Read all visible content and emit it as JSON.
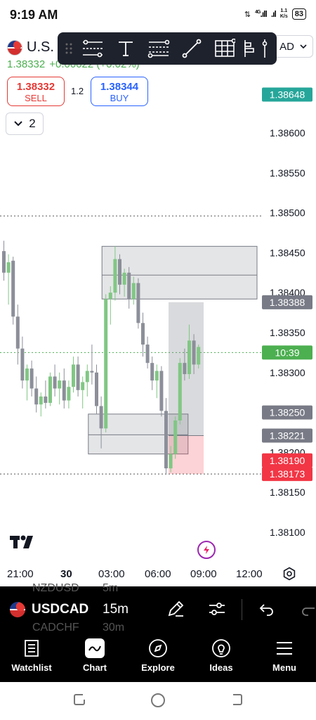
{
  "status_bar": {
    "time": "9:19 AM",
    "network": "4G",
    "speed_value": "1.1",
    "speed_unit": "K/s",
    "battery": "83"
  },
  "header": {
    "symbol": "U.S.",
    "last_price": "1.38332",
    "change": "+0.00022 (+0.02%)",
    "currency": "AD"
  },
  "drawing_toolbar": {
    "tools": [
      "grip-icon",
      "trend-channel-icon",
      "text-icon",
      "fib-icon",
      "trend-line-icon",
      "grid-icon",
      "long-position-icon",
      "vertical-line-icon"
    ]
  },
  "trade": {
    "sell_price": "1.38332",
    "sell_label": "SELL",
    "spread": "1.2",
    "buy_price": "1.38344",
    "buy_label": "BUY"
  },
  "indicators": {
    "count": "2"
  },
  "chart_data": {
    "type": "candlestick",
    "symbol": "USDCAD",
    "interval": "15m",
    "y_ticks": [
      1.381,
      1.3815,
      1.382,
      1.3825,
      1.383,
      1.3835,
      1.384,
      1.3845,
      1.385,
      1.3855,
      1.386
    ],
    "y_tick_labels": [
      "1.38100",
      "1.38150",
      "1.38200",
      "1.38250",
      "1.38300",
      "1.38350",
      "1.38400",
      "1.38450",
      "1.38500",
      "1.38550",
      "1.38600"
    ],
    "ylim": [
      1.3805,
      1.3866
    ],
    "x_ticks": [
      "21:00",
      "30",
      "03:00",
      "06:00",
      "09:00",
      "12:00"
    ],
    "price_tags": [
      {
        "label": "1.38648",
        "value": 1.38648,
        "color": "#26a69a"
      },
      {
        "label": "1.38388",
        "value": 1.38388,
        "color": "#787b86"
      },
      {
        "label": "10:39",
        "value": 1.38325,
        "color": "#4caf50"
      },
      {
        "label": "1.38250",
        "value": 1.3825,
        "color": "#787b86"
      },
      {
        "label": "1.38221",
        "value": 1.38221,
        "color": "#787b86"
      },
      {
        "label": "1.38190",
        "value": 1.3819,
        "color": "#f23645"
      },
      {
        "label": "1.38173",
        "value": 1.38173,
        "color": "#f23645"
      }
    ],
    "dotted_lines": [
      1.38496,
      1.38325,
      1.38173
    ],
    "candles": [
      {
        "o": 1.38452,
        "h": 1.38465,
        "l": 1.38415,
        "c": 1.38425
      },
      {
        "o": 1.38425,
        "h": 1.38448,
        "l": 1.38385,
        "c": 1.38438
      },
      {
        "o": 1.3844,
        "h": 1.38445,
        "l": 1.3836,
        "c": 1.3837
      },
      {
        "o": 1.3837,
        "h": 1.38385,
        "l": 1.3831,
        "c": 1.3833
      },
      {
        "o": 1.3833,
        "h": 1.38345,
        "l": 1.3828,
        "c": 1.3829
      },
      {
        "o": 1.3829,
        "h": 1.3831,
        "l": 1.38265,
        "c": 1.38305
      },
      {
        "o": 1.38305,
        "h": 1.38315,
        "l": 1.3827,
        "c": 1.3828
      },
      {
        "o": 1.3828,
        "h": 1.38295,
        "l": 1.3825,
        "c": 1.3826
      },
      {
        "o": 1.3826,
        "h": 1.38275,
        "l": 1.38245,
        "c": 1.3827
      },
      {
        "o": 1.3827,
        "h": 1.3829,
        "l": 1.38255,
        "c": 1.38262
      },
      {
        "o": 1.38262,
        "h": 1.383,
        "l": 1.38258,
        "c": 1.38295
      },
      {
        "o": 1.38295,
        "h": 1.3831,
        "l": 1.3827,
        "c": 1.3828
      },
      {
        "o": 1.3828,
        "h": 1.383,
        "l": 1.3826,
        "c": 1.3829
      },
      {
        "o": 1.3829,
        "h": 1.38305,
        "l": 1.38255,
        "c": 1.38265
      },
      {
        "o": 1.38265,
        "h": 1.3829,
        "l": 1.38255,
        "c": 1.38282
      },
      {
        "o": 1.38282,
        "h": 1.3832,
        "l": 1.38275,
        "c": 1.3831
      },
      {
        "o": 1.3831,
        "h": 1.3832,
        "l": 1.3827,
        "c": 1.38278
      },
      {
        "o": 1.38278,
        "h": 1.38295,
        "l": 1.38255,
        "c": 1.38288
      },
      {
        "o": 1.38288,
        "h": 1.3831,
        "l": 1.3827,
        "c": 1.38302
      },
      {
        "o": 1.38302,
        "h": 1.38335,
        "l": 1.38285,
        "c": 1.383
      },
      {
        "o": 1.383,
        "h": 1.3831,
        "l": 1.38248,
        "c": 1.38258
      },
      {
        "o": 1.38258,
        "h": 1.3827,
        "l": 1.38205,
        "c": 1.3823
      },
      {
        "o": 1.3823,
        "h": 1.38398,
        "l": 1.38225,
        "c": 1.38392
      },
      {
        "o": 1.38392,
        "h": 1.38408,
        "l": 1.3836,
        "c": 1.384
      },
      {
        "o": 1.384,
        "h": 1.38458,
        "l": 1.3839,
        "c": 1.38442
      },
      {
        "o": 1.38442,
        "h": 1.38448,
        "l": 1.38398,
        "c": 1.3841
      },
      {
        "o": 1.3841,
        "h": 1.3843,
        "l": 1.38395,
        "c": 1.38425
      },
      {
        "o": 1.38425,
        "h": 1.38432,
        "l": 1.3838,
        "c": 1.38392
      },
      {
        "o": 1.38392,
        "h": 1.3842,
        "l": 1.38385,
        "c": 1.38412
      },
      {
        "o": 1.38412,
        "h": 1.38418,
        "l": 1.38355,
        "c": 1.38362
      },
      {
        "o": 1.38362,
        "h": 1.38375,
        "l": 1.3832,
        "c": 1.38335
      },
      {
        "o": 1.38335,
        "h": 1.38345,
        "l": 1.38305,
        "c": 1.38312
      },
      {
        "o": 1.38312,
        "h": 1.3832,
        "l": 1.38278,
        "c": 1.3829
      },
      {
        "o": 1.3829,
        "h": 1.3831,
        "l": 1.38268,
        "c": 1.38302
      },
      {
        "o": 1.38302,
        "h": 1.38308,
        "l": 1.38245,
        "c": 1.38252
      },
      {
        "o": 1.38252,
        "h": 1.38268,
        "l": 1.38172,
        "c": 1.3818
      },
      {
        "o": 1.3818,
        "h": 1.38208,
        "l": 1.38175,
        "c": 1.38198
      },
      {
        "o": 1.38198,
        "h": 1.38245,
        "l": 1.38192,
        "c": 1.3824
      },
      {
        "o": 1.3824,
        "h": 1.38318,
        "l": 1.38235,
        "c": 1.38312
      },
      {
        "o": 1.38312,
        "h": 1.3833,
        "l": 1.3829,
        "c": 1.38298
      },
      {
        "o": 1.38298,
        "h": 1.3836,
        "l": 1.38292,
        "c": 1.3834
      },
      {
        "o": 1.3834,
        "h": 1.38348,
        "l": 1.38298,
        "c": 1.3831
      },
      {
        "o": 1.3831,
        "h": 1.38335,
        "l": 1.38305,
        "c": 1.38332
      }
    ],
    "drawings": {
      "rect_zone_top": {
        "x0": 22,
        "x1": 53,
        "y0": 1.38392,
        "y1": 1.38458
      },
      "rect_zone_bottom": {
        "x0": 18,
        "x1": 38,
        "y0": 1.38198,
        "y1": 1.38248
      },
      "long_position": {
        "x0": 35,
        "x1": 39,
        "entry": 1.38221,
        "target": 1.38388,
        "stop": 1.38173
      }
    }
  },
  "time_axis": {
    "labels": [
      "21:00",
      "30",
      "03:00",
      "06:00",
      "09:00",
      "12:00"
    ]
  },
  "chart_toolbar": {
    "ghost_above": [
      "NZDUSD",
      "5m"
    ],
    "ghost_below": [
      "CADCHF",
      "30m"
    ],
    "symbol": "USDCAD",
    "interval": "15m"
  },
  "nav": {
    "items": [
      {
        "label": "Watchlist",
        "icon": "watchlist-icon"
      },
      {
        "label": "Chart",
        "icon": "chart-icon"
      },
      {
        "label": "Explore",
        "icon": "compass-icon"
      },
      {
        "label": "Ideas",
        "icon": "bulb-icon"
      },
      {
        "label": "Menu",
        "icon": "hamburger-icon"
      }
    ]
  }
}
